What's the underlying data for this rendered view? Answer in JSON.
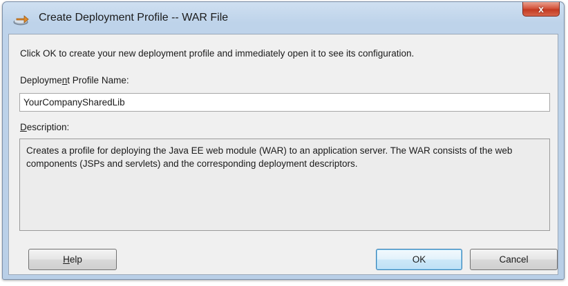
{
  "window": {
    "title": "Create Deployment Profile -- WAR File",
    "close_symbol": "x",
    "icon": "deployment-profile-icon"
  },
  "dialog": {
    "intro": "Click OK to create your new deployment profile and immediately open it to see its configuration.",
    "name_label_pre": "Deployme",
    "name_label_mnemonic": "n",
    "name_label_post": "t Profile Name:",
    "name_value": "YourCompanySharedLib",
    "description_label_mnemonic": "D",
    "description_label_post": "escription:",
    "description_text": "Creates a profile for deploying the Java EE web module (WAR) to an application server. The WAR consists of the web components (JSPs and servlets) and the corresponding deployment descriptors."
  },
  "buttons": {
    "help_mnemonic": "H",
    "help_post": "elp",
    "ok": "OK",
    "cancel": "Cancel"
  },
  "colors": {
    "title_bar": "#bed3ea",
    "client_bg": "#f0f0f0",
    "close_button": "#c33a22",
    "default_button_border": "#3c7fb1"
  }
}
